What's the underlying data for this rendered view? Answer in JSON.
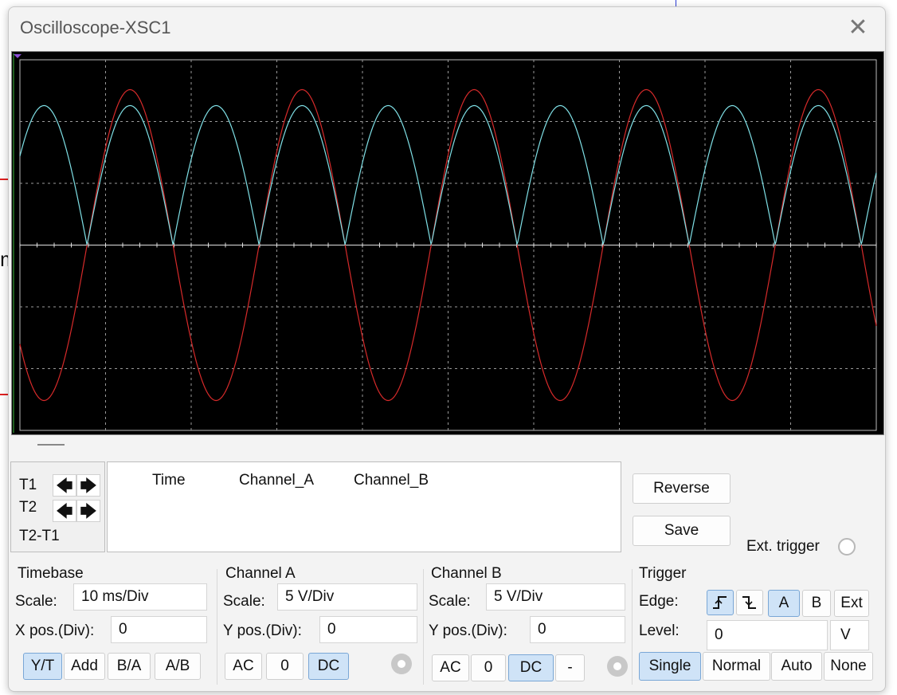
{
  "window": {
    "title": "Oscilloscope-XSC1",
    "close_glyph": "✕"
  },
  "background": {
    "partial_text": "m"
  },
  "cursor": {
    "t1_label": "T1",
    "t2_label": "T2",
    "diff_label": "T2-T1",
    "left_arrow": "🡄",
    "right_arrow": "🡆"
  },
  "readout": {
    "col_time": "Time",
    "col_a": "Channel_A",
    "col_b": "Channel_B"
  },
  "actions": {
    "reverse": "Reverse",
    "save": "Save",
    "ext_trigger": "Ext. trigger"
  },
  "timebase": {
    "title": "Timebase",
    "scale_label": "Scale:",
    "scale_value": "10 ms/Div",
    "xpos_label": "X pos.(Div):",
    "xpos_value": "0",
    "modes": [
      "Y/T",
      "Add",
      "B/A",
      "A/B"
    ],
    "active_mode": "Y/T"
  },
  "channel_a": {
    "title": "Channel A",
    "scale_label": "Scale:",
    "scale_value": "5  V/Div",
    "ypos_label": "Y pos.(Div):",
    "ypos_value": "0",
    "coupling": [
      "AC",
      "0",
      "DC"
    ],
    "active_coupling": "DC"
  },
  "channel_b": {
    "title": "Channel B",
    "scale_label": "Scale:",
    "scale_value": "5  V/Div",
    "ypos_label": "Y pos.(Div):",
    "ypos_value": "0",
    "coupling": [
      "AC",
      "0",
      "DC",
      "-"
    ],
    "active_coupling": "DC"
  },
  "trigger": {
    "title": "Trigger",
    "edge_label": "Edge:",
    "level_label": "Level:",
    "level_value": "0",
    "level_unit": "V",
    "sources": [
      "A",
      "B",
      "Ext"
    ],
    "active_source": "A",
    "modes": [
      "Single",
      "Normal",
      "Auto",
      "None"
    ],
    "active_mode": "Single",
    "rising_icon": "rising-edge-icon",
    "falling_icon": "falling-edge-icon"
  },
  "colors": {
    "channel_a": "#d62a2a",
    "channel_b": "#7fe0e6",
    "grid": "#9a9a9a",
    "screen": "#000000"
  }
}
